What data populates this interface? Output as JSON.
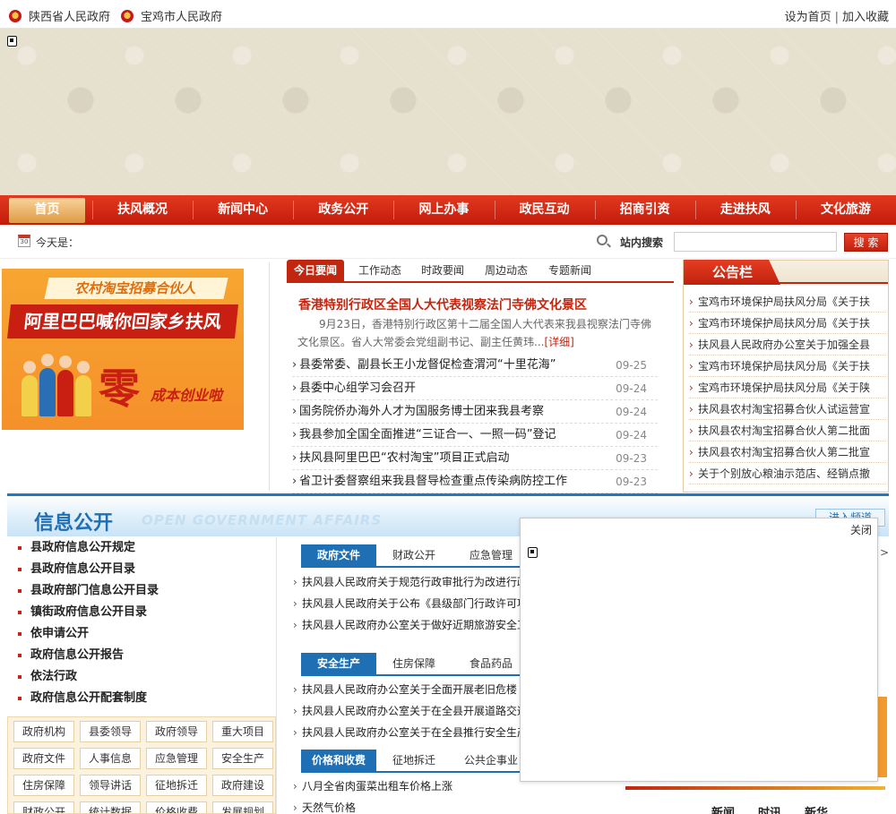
{
  "topbar": {
    "site1": "陕西省人民政府",
    "site2": "宝鸡市人民政府",
    "set_home": "设为首页",
    "favorite": "加入收藏",
    "separator": "|"
  },
  "nav": [
    "首页",
    "扶风概况",
    "新闻中心",
    "政务公开",
    "网上办事",
    "政民互动",
    "招商引资",
    "走进扶风",
    "文化旅游"
  ],
  "info": {
    "today_label": "今天是：",
    "calendar_day": "30",
    "search_label": "站内搜索",
    "search_value": "",
    "search_button": "搜 索"
  },
  "ad": {
    "line1": "农村淘宝招募合伙人",
    "line2": "阿里巴巴喊你回家乡扶风",
    "zero": "零",
    "slogan": "成本创业啦"
  },
  "news": {
    "tabs": [
      "今日要闻",
      "工作动态",
      "时政要闻",
      "周边动态",
      "专题新闻"
    ],
    "headline": "香港特别行政区全国人大代表视察法门寺佛文化景区",
    "summary": "9月23日，香港特别行政区第十二届全国人大代表来我县视察法门寺佛文化景区。省人大常委会党组副书记、副主任黄玮...",
    "more": "[详细]",
    "items": [
      {
        "title": "县委常委、副县长王小龙督促检查渭河“十里花海”",
        "date": "09-25"
      },
      {
        "title": "县委中心组学习会召开",
        "date": "09-24"
      },
      {
        "title": "国务院侨办海外人才为国服务博士团来我县考察",
        "date": "09-24"
      },
      {
        "title": "我县参加全国全面推进“三证合一、一照一码”登记",
        "date": "09-24"
      },
      {
        "title": "扶风县阿里巴巴“农村淘宝”项目正式启动",
        "date": "09-23"
      },
      {
        "title": "省卫计委督察组来我县督导检查重点传染病防控工作",
        "date": "09-23"
      }
    ]
  },
  "notice": {
    "title": "公告栏",
    "items": [
      "宝鸡市环境保护局扶风分局《关于扶",
      "宝鸡市环境保护局扶风分局《关于扶",
      "扶风县人民政府办公室关于加强全县",
      "宝鸡市环境保护局扶风分局《关于扶",
      "宝鸡市环境保护局扶风分局《关于陕",
      "扶风县农村淘宝招募合伙人试运营宣",
      "扶风县农村淘宝招募合伙人第二批面",
      "扶风县农村淘宝招募合伙人第二批宣",
      "关于个别放心粮油示范店、经销点撤"
    ]
  },
  "gov": {
    "title": "信息公开",
    "subtitle": "OPEN GOVERNMENT AFFAIRS",
    "enter": "进入频道",
    "left_items": [
      "县政府信息公开规定",
      "县政府信息公开目录",
      "县政府部门信息公开目录",
      "镇街政府信息公开目录",
      "依申请公开",
      "政府信息公开报告",
      "依法行政",
      "政府信息公开配套制度"
    ],
    "grid": [
      "政府机构",
      "县委领导",
      "政府领导",
      "重大项目",
      "政府文件",
      "人事信息",
      "应急管理",
      "安全生产",
      "住房保障",
      "领导讲话",
      "征地拆迁",
      "政府建设",
      "财政公开",
      "统计数据",
      "价格收费",
      "发展规划"
    ],
    "group1": {
      "tabs": [
        "政府文件",
        "财政公开",
        "应急管理"
      ],
      "items": [
        "扶风县人民政府关于规范行政审批行为改进行政",
        "扶风县人民政府关于公布《县级部门行政许可项",
        "扶风县人民政府办公室关于做好近期旅游安全工"
      ]
    },
    "group2": {
      "tabs": [
        "安全生产",
        "住房保障",
        "食品药品"
      ],
      "items": [
        "扶风县人民政府办公室关于全面开展老旧危楼",
        "扶风县人民政府办公室关于在全县开展道路交通",
        "扶风县人民政府办公室关于在全县推行安全生产"
      ]
    },
    "group3": {
      "tabs": [
        "价格和收费",
        "征地拆迁",
        "公共企事业"
      ],
      "items": [
        "八月全省肉蛋菜出租车价格上涨",
        "天然气价格"
      ]
    }
  },
  "popup": {
    "close": "关闭",
    "arrow": ">"
  },
  "bottom_tabs": [
    "新闻",
    "时讯",
    "新华"
  ]
}
